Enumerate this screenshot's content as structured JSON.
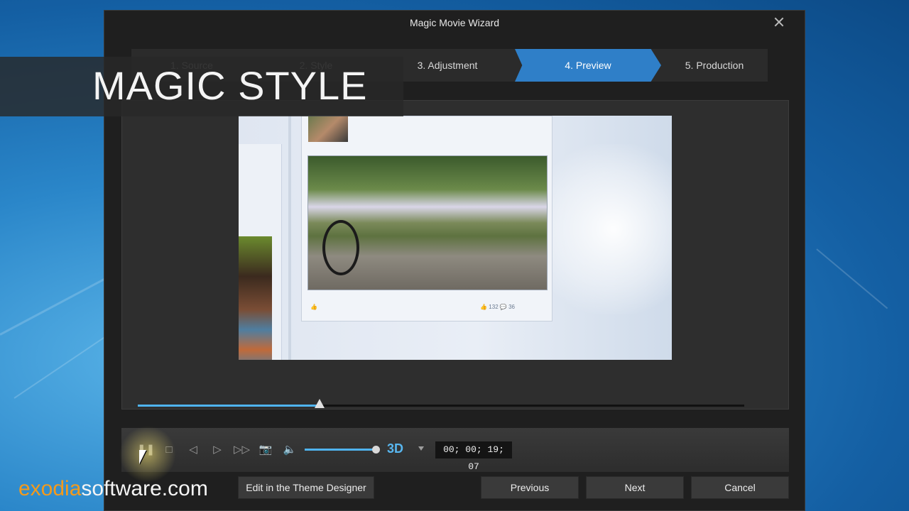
{
  "window": {
    "title": "Magic Movie Wizard"
  },
  "steps": [
    {
      "label": "1. Source"
    },
    {
      "label": "2. Style"
    },
    {
      "label": "3. Adjustment"
    },
    {
      "label": "4. Preview"
    },
    {
      "label": "5. Production"
    }
  ],
  "preview": {
    "likes": "132",
    "comments": "36"
  },
  "playback": {
    "progress": 0.3,
    "volume": 1.0,
    "mode_label": "3D",
    "timecode": "00; 00; 19; 07"
  },
  "buttons": {
    "theme_designer": "Edit in the Theme Designer",
    "previous": "Previous",
    "next": "Next",
    "cancel": "Cancel"
  },
  "overlay": {
    "title": "MAGIC STYLE"
  },
  "watermark": {
    "part1": "exodia",
    "part2": "software",
    "part3": ".com"
  },
  "colors": {
    "accent": "#2f7fc8",
    "progress": "#4fb3ee",
    "watermark_accent": "#f39a1c"
  }
}
